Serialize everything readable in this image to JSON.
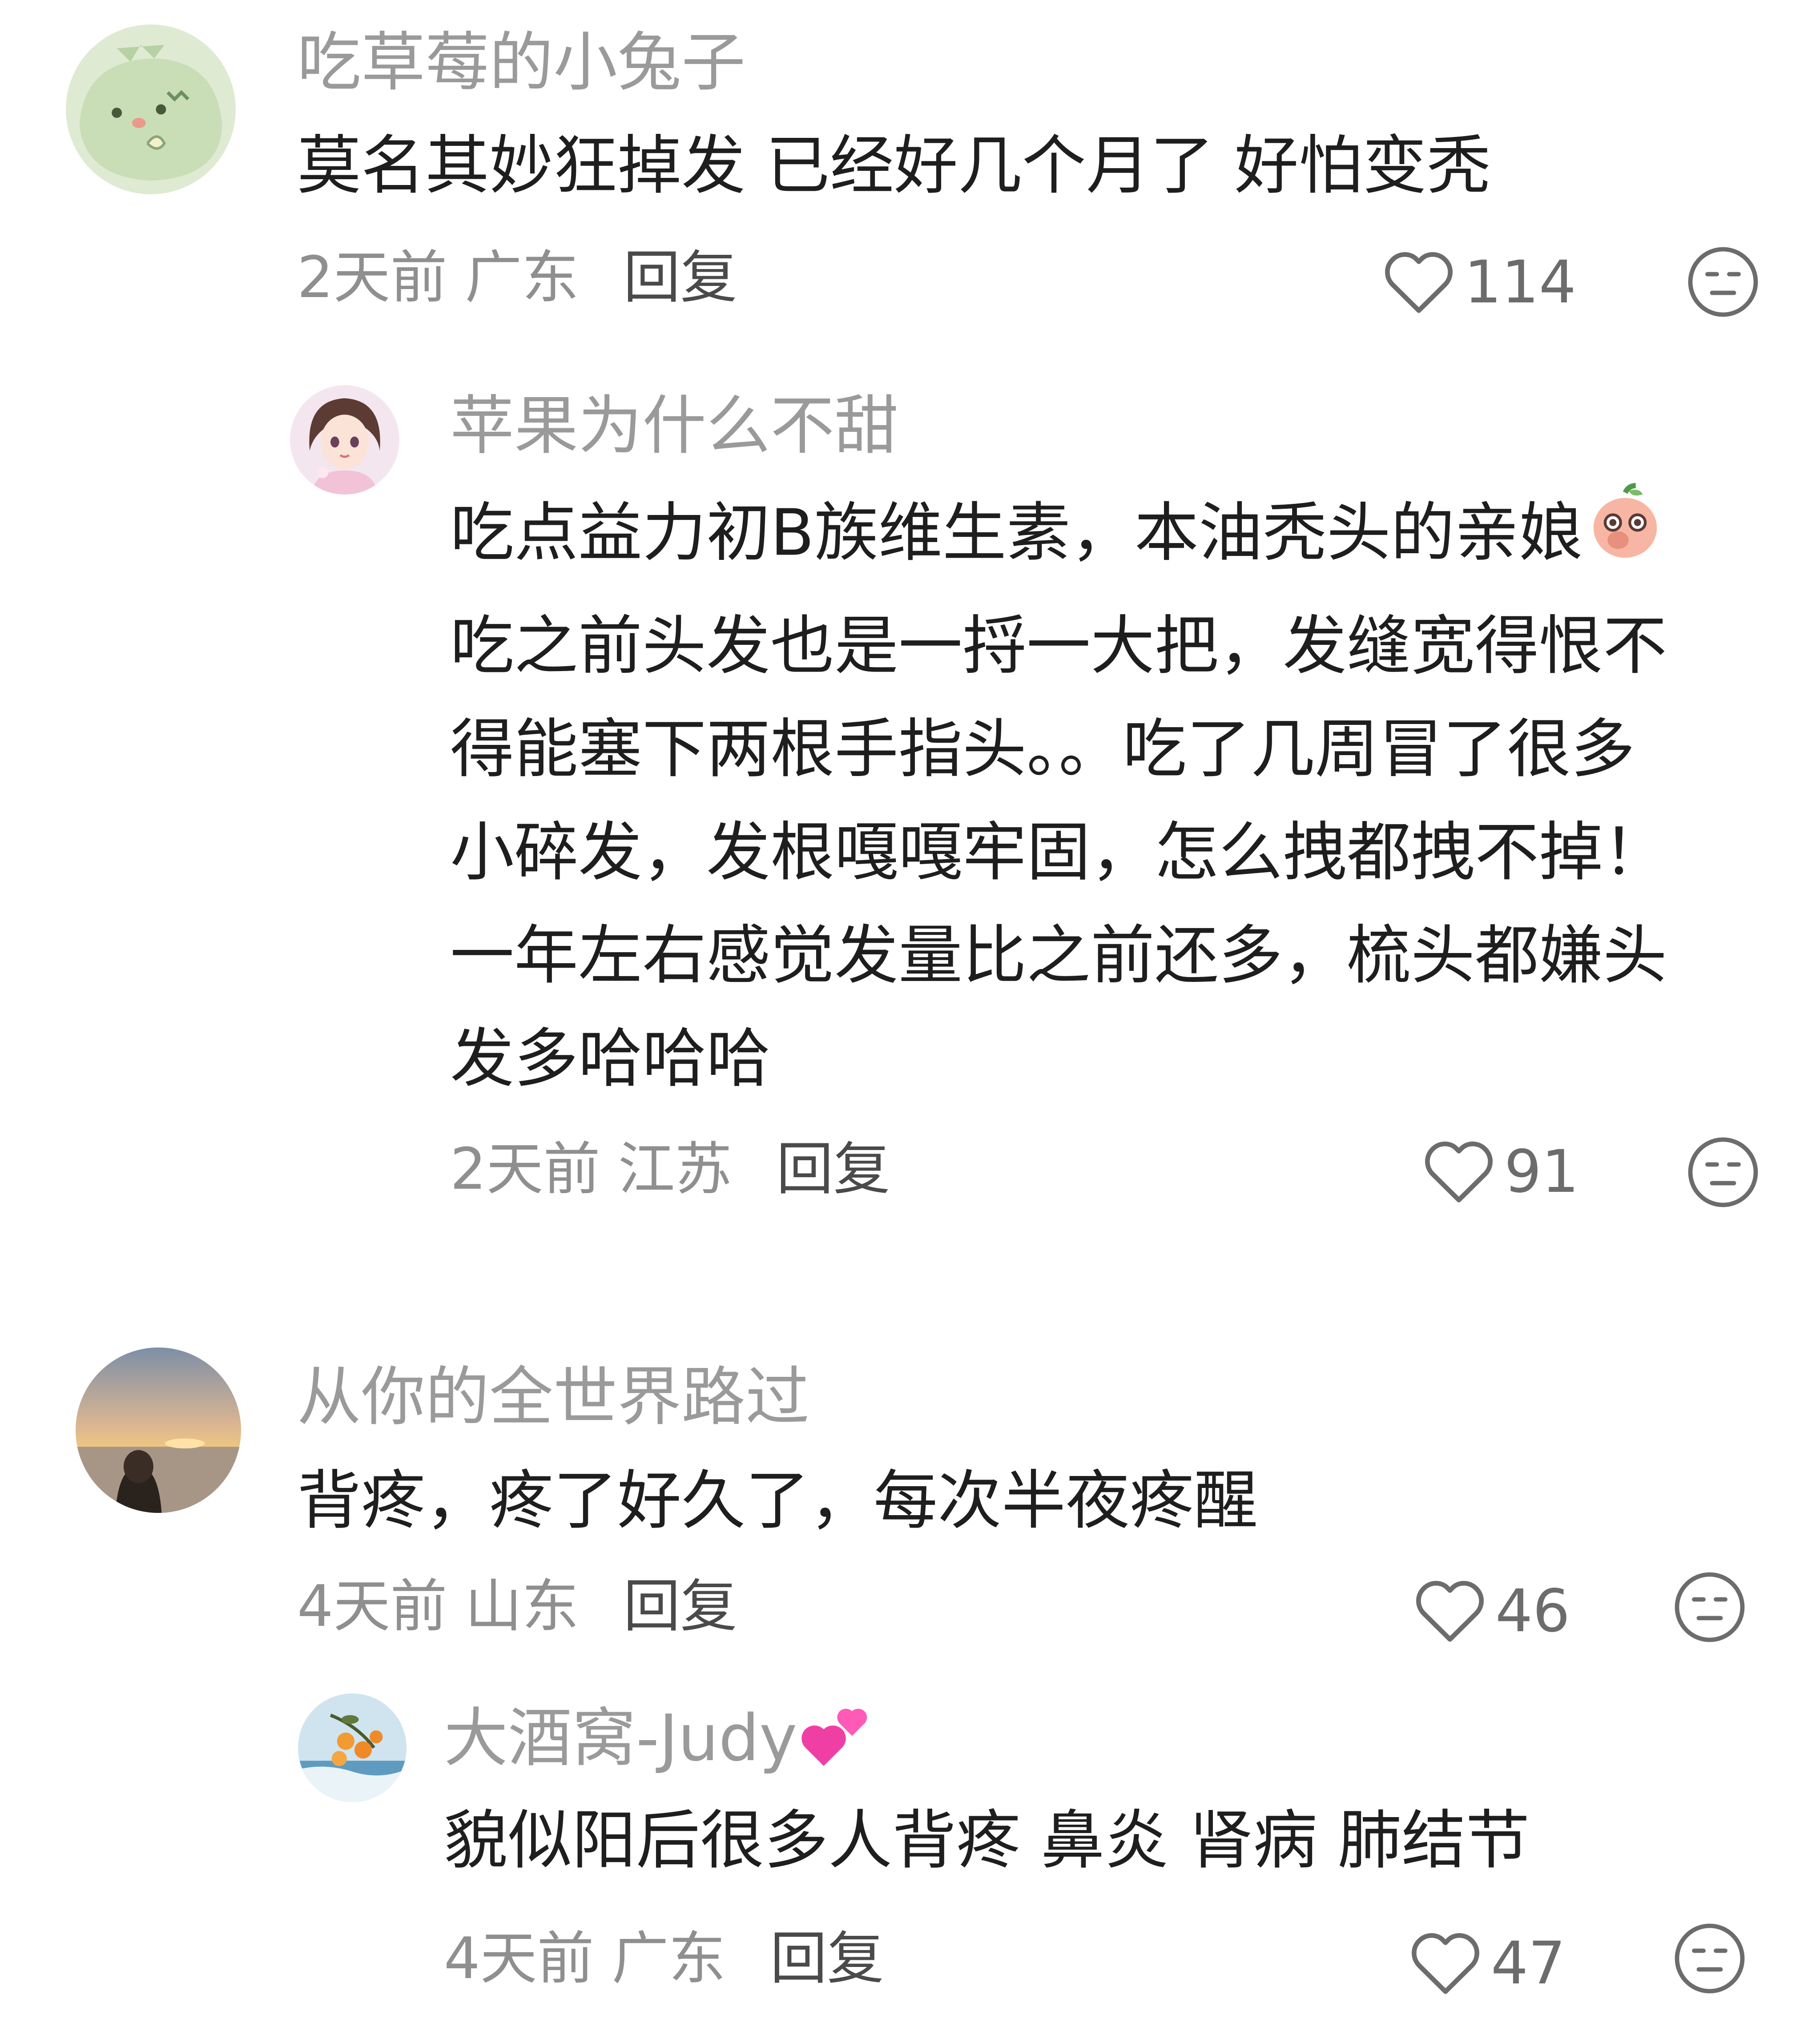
{
  "comments": [
    {
      "username": "吃草莓的小兔子",
      "lines": [
        "莫名其妙狂掉发 已经好几个月了 好怕变秃"
      ],
      "time": "2天前",
      "location": "广东",
      "reply": "回复",
      "likes": "114",
      "avatar_icon": "green-dino-avatar"
    },
    {
      "username": "苹果为什么不甜",
      "lines": [
        "吃点益力初B族维生素，本油秃头的亲娘",
        "吃之前头发也是一捋一大把，发缝宽得恨不",
        "得能塞下两根手指头。。吃了几周冒了很多",
        "小碎发，发根嘎嘎牢固，怎么拽都拽不掉！",
        "一年左右感觉发量比之前还多，梳头都嫌头",
        "发多哈哈哈"
      ],
      "time": "2天前",
      "location": "江苏",
      "reply": "回复",
      "likes": "91",
      "avatar_icon": "anime-girl-avatar",
      "inline_emoji": "peach-face-emoji"
    },
    {
      "username": "从你的全世界路过",
      "lines": [
        "背疼，疼了好久了，每次半夜疼醒"
      ],
      "time": "4天前",
      "location": "山东",
      "reply": "回复",
      "likes": "46",
      "avatar_icon": "sunset-photo-avatar"
    },
    {
      "username": "大酒窝-Judy",
      "name_emoji": "two-hearts-emoji",
      "lines": [
        "貌似阳后很多人背疼 鼻炎 肾病 肺结节"
      ],
      "time": "4天前",
      "location": "广东",
      "reply": "回复",
      "likes": "47",
      "avatar_icon": "oranges-photo-avatar"
    }
  ],
  "colors": {
    "username": "#9a9a9a",
    "text": "#1e1e1e",
    "meta": "#8f8f8f",
    "reply": "#4a4a4a",
    "icon": "#6c6c6c"
  }
}
